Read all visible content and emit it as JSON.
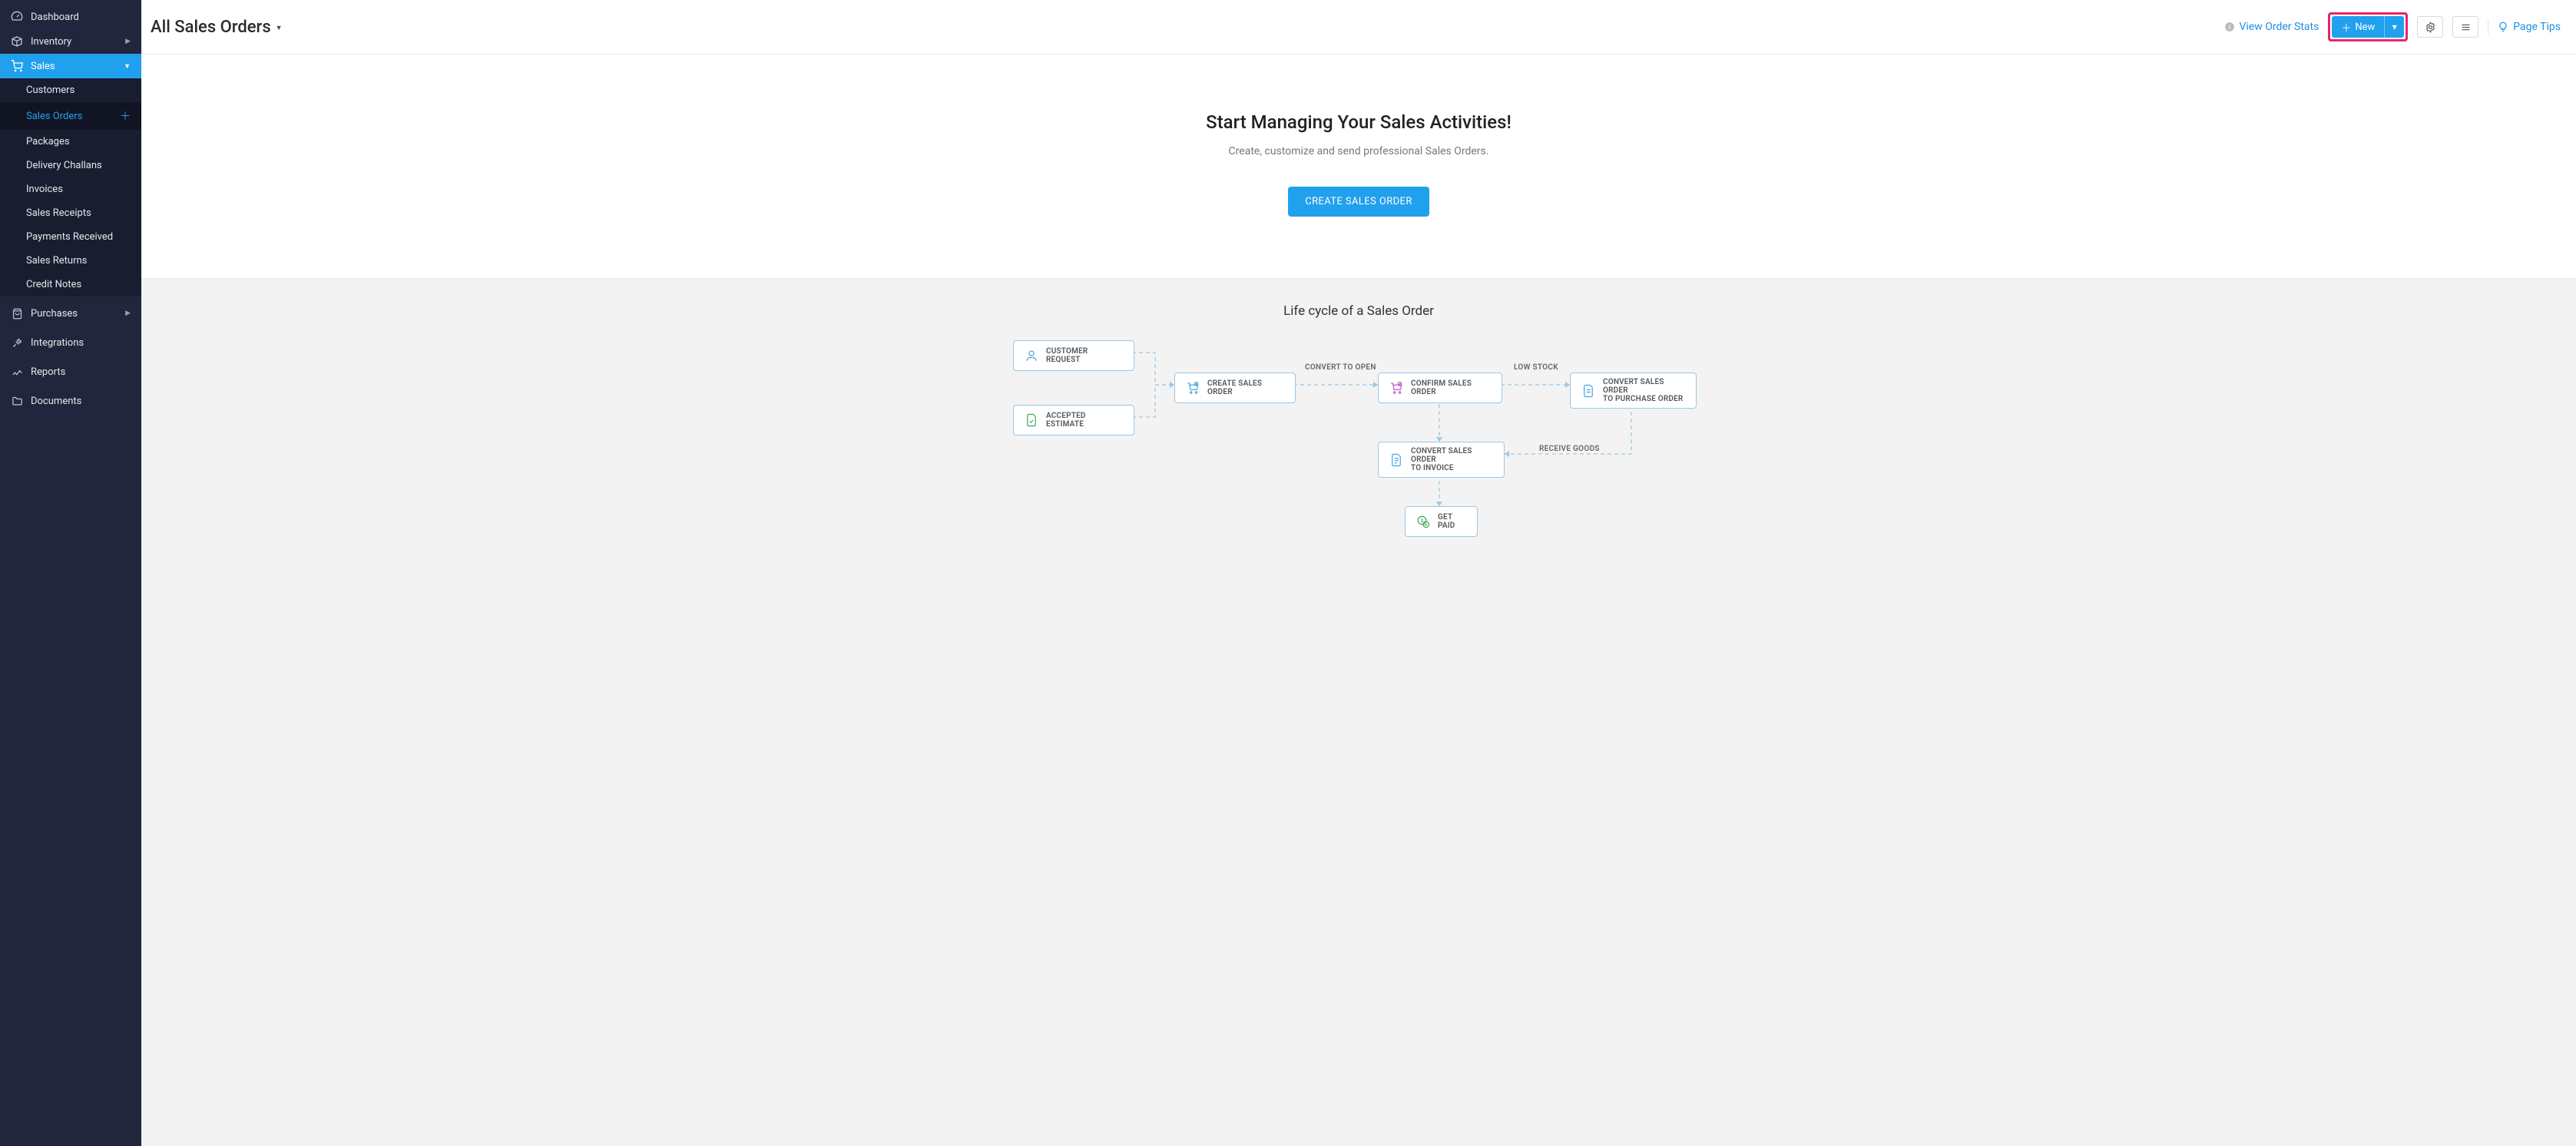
{
  "sidebar": {
    "dashboard": "Dashboard",
    "inventory": "Inventory",
    "sales": "Sales",
    "sales_sub": {
      "customers": "Customers",
      "sales_orders": "Sales Orders",
      "packages": "Packages",
      "delivery_challans": "Delivery Challans",
      "invoices": "Invoices",
      "sales_receipts": "Sales Receipts",
      "payments_received": "Payments Received",
      "sales_returns": "Sales Returns",
      "credit_notes": "Credit Notes"
    },
    "purchases": "Purchases",
    "integrations": "Integrations",
    "reports": "Reports",
    "documents": "Documents"
  },
  "header": {
    "title": "All Sales Orders",
    "view_order_stats": "View Order Stats",
    "new_label": "New",
    "page_tips": "Page Tips"
  },
  "hero": {
    "title": "Start Managing Your Sales Activities!",
    "subtitle": "Create, customize and send professional Sales Orders.",
    "cta": "CREATE SALES ORDER"
  },
  "lifecycle": {
    "title": "Life cycle of a Sales Order",
    "boxes": {
      "customer_request": "CUSTOMER REQUEST",
      "accepted_estimate": "ACCEPTED ESTIMATE",
      "create_sales_order": "CREATE SALES ORDER",
      "confirm_sales_order": "CONFIRM SALES ORDER",
      "convert_to_invoice_l1": "CONVERT SALES ORDER",
      "convert_to_invoice_l2": "TO INVOICE",
      "convert_to_po_l1": "CONVERT SALES ORDER",
      "convert_to_po_l2": "TO PURCHASE ORDER",
      "get_paid": "GET PAID"
    },
    "labels": {
      "convert_to_open": "CONVERT TO OPEN",
      "low_stock": "LOW STOCK",
      "receive_goods": "RECEIVE GOODS"
    }
  }
}
